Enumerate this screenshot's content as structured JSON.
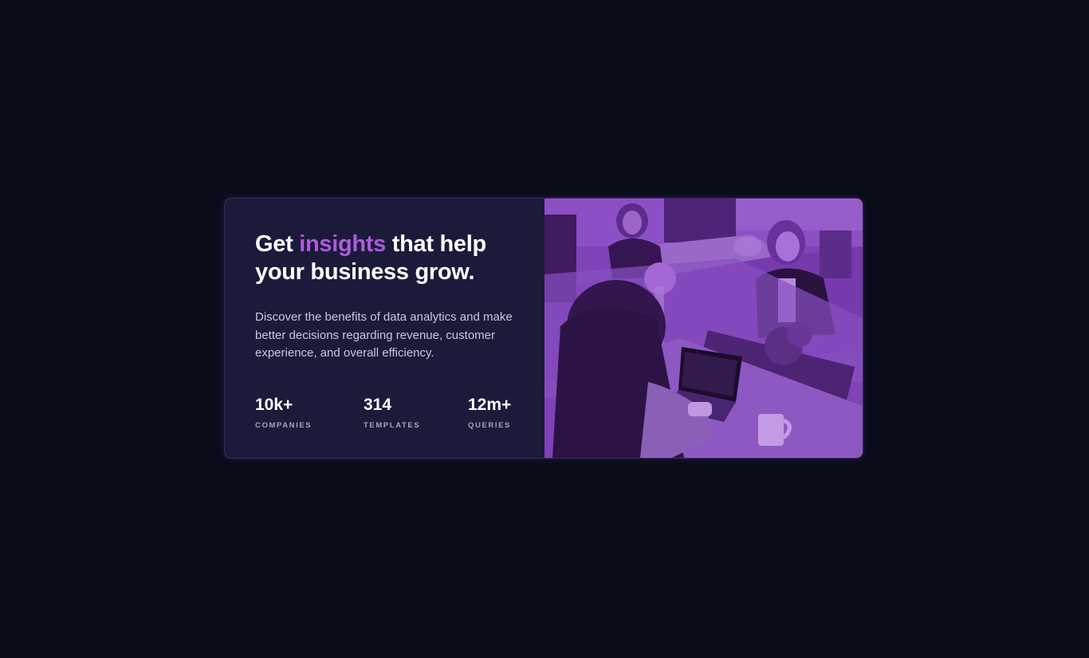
{
  "card": {
    "headline_pre": "Get ",
    "headline_accent": "insights",
    "headline_post": " that help your business grow.",
    "description": "Discover the benefits of data analytics and make better decisions regarding revenue, customer experience, and overall efficiency.",
    "stats": [
      {
        "value": "10k+",
        "label": "Companies"
      },
      {
        "value": "314",
        "label": "Templates"
      },
      {
        "value": "12m+",
        "label": "Queries"
      }
    ],
    "image_description": "people-working-with-laptops-photo"
  },
  "colors": {
    "page_background": "#0a0c1a",
    "card_background": "#1c1a3a",
    "accent": "#ab5cdb",
    "heading_text": "#ffffff",
    "body_text": "#c9c6dd",
    "stat_label_text": "#a7a3bd",
    "image_overlay": "#9b59c9"
  }
}
